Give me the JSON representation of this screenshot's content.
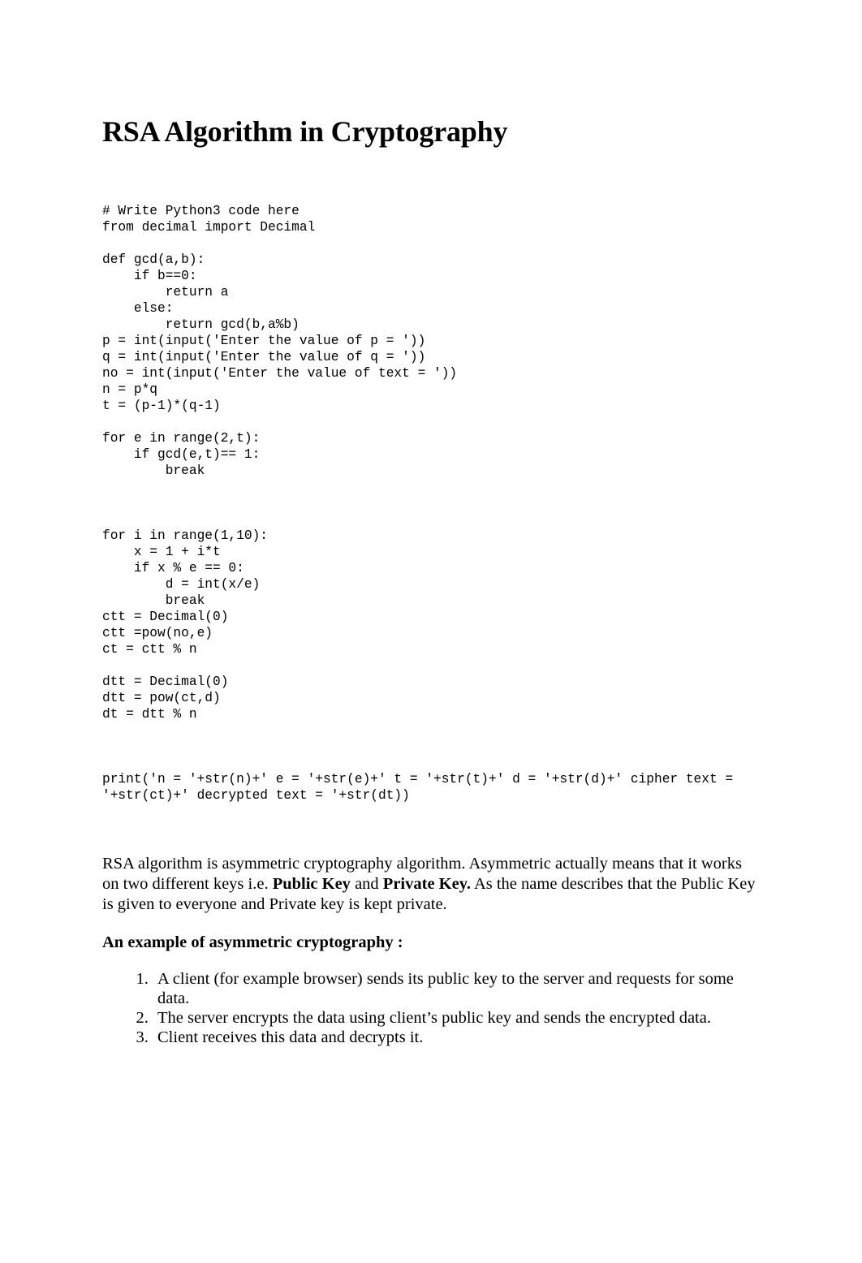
{
  "document": {
    "title": "RSA Algorithm in Cryptography",
    "code": {
      "language": "python",
      "lines": [
        "# Write Python3 code here",
        "from decimal import Decimal",
        "",
        "def gcd(a,b):",
        "    if b==0:",
        "        return a",
        "    else:",
        "        return gcd(b,a%b)",
        "p = int(input('Enter the value of p = '))",
        "q = int(input('Enter the value of q = '))",
        "no = int(input('Enter the value of text = '))",
        "n = p*q",
        "t = (p-1)*(q-1)",
        "",
        "for e in range(2,t):",
        "    if gcd(e,t)== 1:",
        "        break",
        "",
        "",
        "",
        "for i in range(1,10):",
        "    x = 1 + i*t",
        "    if x % e == 0:",
        "        d = int(x/e)",
        "        break",
        "ctt = Decimal(0)",
        "ctt =pow(no,e)",
        "ct = ctt % n",
        "",
        "dtt = Decimal(0)",
        "dtt = pow(ct,d)",
        "dt = dtt % n",
        ""
      ],
      "print_statement": "print('n = '+str(n)+' e = '+str(e)+' t = '+str(t)+' d = '+str(d)+' cipher text = '+str(ct)+' decrypted text = '+str(dt))"
    },
    "paragraph": {
      "part1": "RSA algorithm is asymmetric cryptography algorithm. Asymmetric actually means that it works on two different keys i.e. ",
      "bold1": "Public Key",
      "part2": " and ",
      "bold2": "Private Key.",
      "part3": " As the name describes that the Public Key is given to everyone and Private key is kept private."
    },
    "subheading": "An example of asymmetric cryptography :",
    "steps": [
      "A client (for example browser) sends its public key to the server and requests for some data.",
      "The server encrypts the data using client’s public key and sends the encrypted data.",
      "Client receives this data and decrypts it."
    ]
  }
}
